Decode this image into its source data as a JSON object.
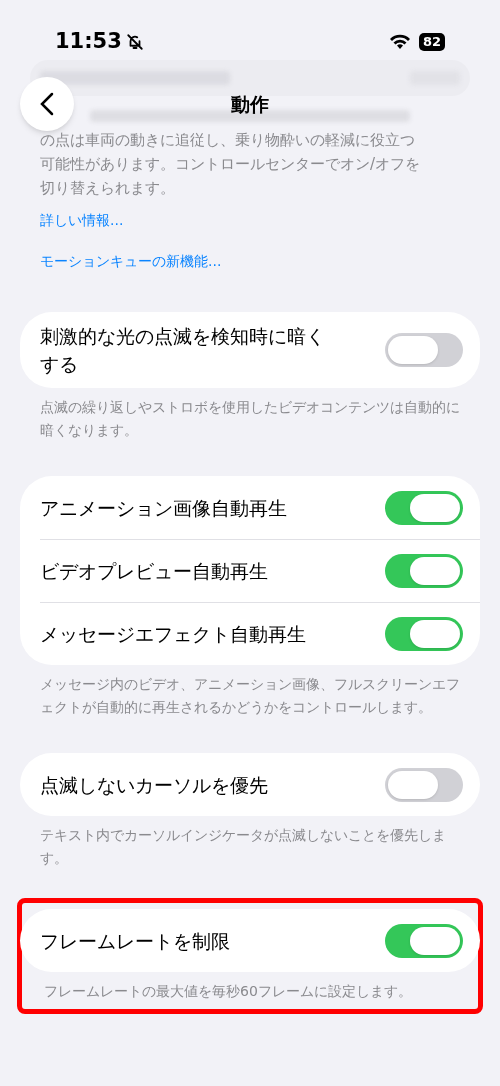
{
  "status_bar": {
    "time": "11:53",
    "silent": true,
    "battery": "82"
  },
  "nav": {
    "title": "動作"
  },
  "behind": {
    "description_lines": [
      "の点は車両の動きに追従し、乗り物酔いの軽減に役立つ",
      "可能性があります。コントロールセンターでオン/オフを",
      "切り替えられます。"
    ],
    "links": [
      "詳しい情報...",
      "モーションキューの新機能..."
    ]
  },
  "sections": [
    {
      "highlighted": false,
      "rows": [
        {
          "label": "刺激的な光の点滅を検知時に暗くする",
          "on": false
        }
      ],
      "footer": "点滅の繰り返しやストロボを使用したビデオコンテンツは自動的に暗くなります。"
    },
    {
      "highlighted": false,
      "rows": [
        {
          "label": "アニメーション画像自動再生",
          "on": true
        },
        {
          "label": "ビデオプレビュー自動再生",
          "on": true
        },
        {
          "label": "メッセージエフェクト自動再生",
          "on": true
        }
      ],
      "footer": "メッセージ内のビデオ、アニメーション画像、フルスクリーンエフェクトが自動的に再生されるかどうかをコントロールします。"
    },
    {
      "highlighted": false,
      "rows": [
        {
          "label": "点滅しないカーソルを優先",
          "on": false
        }
      ],
      "footer": "テキスト内でカーソルインジケータが点滅しないことを優先します。"
    },
    {
      "highlighted": true,
      "rows": [
        {
          "label": "フレームレートを制限",
          "on": true
        }
      ],
      "footer": "フレームレートの最大値を毎秒60フレームに設定します。"
    }
  ]
}
